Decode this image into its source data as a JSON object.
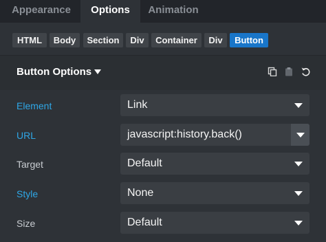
{
  "tabs": [
    "Appearance",
    "Options",
    "Animation"
  ],
  "breadcrumbs": [
    "HTML",
    "Body",
    "Section",
    "Div",
    "Container",
    "Div",
    "Button"
  ],
  "panel": {
    "title": "Button Options",
    "icons": [
      "copy-icon",
      "clipboard-icon",
      "undo-icon"
    ]
  },
  "rows": [
    {
      "label": "Element",
      "value": "Link",
      "label_color": "#2fa7e6"
    },
    {
      "label": "URL",
      "value": "javascript:history.back()",
      "label_color": "#2fa7e6"
    },
    {
      "label": "Target",
      "value": "Default",
      "label_color": "#c8ccd1"
    },
    {
      "label": "Style",
      "value": "None",
      "label_color": "#2fa7e6"
    },
    {
      "label": "Size",
      "value": "Default",
      "label_color": "#c8ccd1"
    }
  ],
  "colors": {
    "accent": "#1976c9",
    "label_highlight": "#2fa7e6"
  }
}
